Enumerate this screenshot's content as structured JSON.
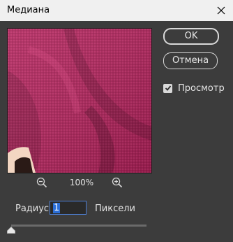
{
  "window": {
    "title": "Медиана"
  },
  "buttons": {
    "ok": "OK",
    "cancel": "Отмена"
  },
  "preview_toggle": {
    "label": "Просмотр",
    "checked": true
  },
  "zoom": {
    "value": "100%"
  },
  "radius": {
    "label": "Радиус:",
    "value": "1",
    "units": "Пиксели"
  },
  "slider": {
    "value_fraction": 0.0
  },
  "colors": {
    "fabric": "#b0245b",
    "accent": "#2c6fd8"
  },
  "icons": [
    "close-icon",
    "checkmark-icon",
    "zoom-out-icon",
    "zoom-in-icon",
    "slider-thumb-icon"
  ]
}
